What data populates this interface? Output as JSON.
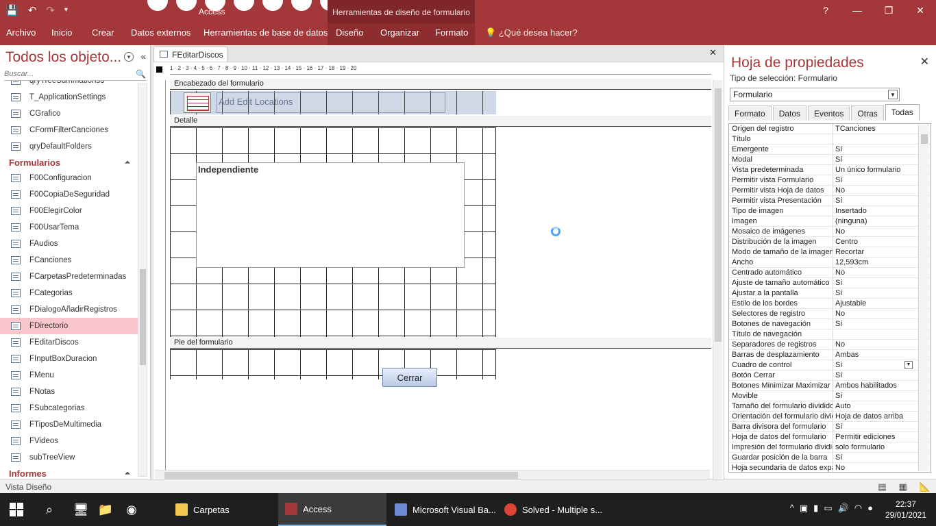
{
  "titlebar": {
    "app_title": "Access",
    "context_title": "Herramientas de diseño de formulario",
    "help": "?",
    "minimize": "—",
    "restore": "❐",
    "close": "✕"
  },
  "ribbon": {
    "tabs": [
      "Archivo",
      "Inicio",
      "Crear",
      "Datos externos",
      "Herramientas de base de datos",
      "Diseño",
      "Organizar",
      "Formato"
    ],
    "tell_me": "¿Qué desea hacer?"
  },
  "nav": {
    "title": "Todos los objeto...",
    "search_placeholder": "Buscar...",
    "items_top": [
      "qryTreeSummations3",
      "T_ApplicationSettings",
      "CGrafico",
      "CFormFilterCanciones",
      "qryDefaultFolders"
    ],
    "group_forms": "Formularios",
    "forms": [
      "F00Configuracion",
      "F00CopiaDeSeguridad",
      "F00ElegirColor",
      "F00UsarTema",
      "FAudios",
      "FCanciones",
      "FCarpetasPredeterminadas",
      "FCategorias",
      "FDialogoAñadirRegistros",
      "FDirectorio",
      "FEditarDiscos",
      "FInputBoxDuracion",
      "FMenu",
      "FNotas",
      "FSubcategorias",
      "FTiposDeMultimedia",
      "FVideos",
      "subTreeView"
    ],
    "selected_form": "FDirectorio",
    "group_reports": "Informes"
  },
  "doc": {
    "tab_label": "FEditarDiscos",
    "ruler_numbers": "1 · 2 · 3 · 4 · 5 · 6 · 7 · 8 · 9 · 10 · 11 · 12 · 13 · 14 · 15 · 16 · 17 · 18 · 19 · 20",
    "section_header": "Encabezado del formulario",
    "section_detail": "Detalle",
    "section_footer": "Pie del formulario",
    "header_label": "Add Edit Locations",
    "unbound_label": "Independiente",
    "close_button": "Cerrar"
  },
  "props": {
    "title": "Hoja de propiedades",
    "selection_type": "Tipo de selección:  Formulario",
    "combo_value": "Formulario",
    "tabs": [
      "Formato",
      "Datos",
      "Eventos",
      "Otras",
      "Todas"
    ],
    "active_tab": "Todas",
    "rows": [
      [
        "Origen del registro",
        "TCanciones"
      ],
      [
        "Título",
        ""
      ],
      [
        "Emergente",
        "Sí"
      ],
      [
        "Modal",
        "Sí"
      ],
      [
        "Vista predeterminada",
        "Un único formulario"
      ],
      [
        "Permitir vista Formulario",
        "Sí"
      ],
      [
        "Permitir vista Hoja de datos",
        "No"
      ],
      [
        "Permitir vista Presentación",
        "Sí"
      ],
      [
        "Tipo de imagen",
        "Insertado"
      ],
      [
        "Imagen",
        "(ninguna)"
      ],
      [
        "Mosaico de imágenes",
        "No"
      ],
      [
        "Distribución de la imagen",
        "Centro"
      ],
      [
        "Modo de tamaño de la imagen",
        "Recortar"
      ],
      [
        "Ancho",
        "12,593cm"
      ],
      [
        "Centrado automático",
        "No"
      ],
      [
        "Ajuste de tamaño automático",
        "Sí"
      ],
      [
        "Ajustar a la pantalla",
        "Sí"
      ],
      [
        "Estilo de los bordes",
        "Ajustable"
      ],
      [
        "Selectores de registro",
        "No"
      ],
      [
        "Botones de navegación",
        "Sí"
      ],
      [
        "Título de navegación",
        ""
      ],
      [
        "Separadores de registros",
        "No"
      ],
      [
        "Barras de desplazamiento",
        "Ambas"
      ],
      [
        "Cuadro de control",
        "Sí"
      ],
      [
        "Botón Cerrar",
        "Sí"
      ],
      [
        "Botones Minimizar Maximizar",
        "Ambos habilitados"
      ],
      [
        "Movible",
        "Sí"
      ],
      [
        "Tamaño del formulario dividido",
        "Auto"
      ],
      [
        "Orientación del formulario dividido",
        "Hoja de datos arriba"
      ],
      [
        "Barra divisora del formulario",
        "Sí"
      ],
      [
        "Hoja de datos del formulario",
        "Permitir ediciones"
      ],
      [
        "Impresión del formulario dividido",
        "solo formulario"
      ],
      [
        "Guardar posición de la barra",
        "Sí"
      ],
      [
        "Hoja secundaria de datos expandida",
        "No"
      ]
    ]
  },
  "status": {
    "text": "Vista Diseño"
  },
  "taskbar": {
    "tasks": [
      "Carpetas",
      "Access",
      "Microsoft Visual Ba...",
      "Solved - Multiple s..."
    ],
    "time": "22:37",
    "date": "29/01/2021"
  },
  "colors": {
    "accent": "#a4373a",
    "selected": "#f9c7cb"
  }
}
